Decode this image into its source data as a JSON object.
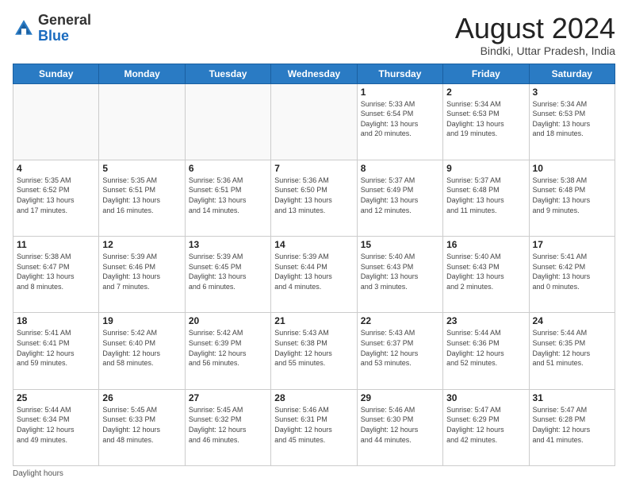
{
  "header": {
    "logo_general": "General",
    "logo_blue": "Blue",
    "month_title": "August 2024",
    "subtitle": "Bindki, Uttar Pradesh, India"
  },
  "days_of_week": [
    "Sunday",
    "Monday",
    "Tuesday",
    "Wednesday",
    "Thursday",
    "Friday",
    "Saturday"
  ],
  "weeks": [
    [
      {
        "day": "",
        "info": ""
      },
      {
        "day": "",
        "info": ""
      },
      {
        "day": "",
        "info": ""
      },
      {
        "day": "",
        "info": ""
      },
      {
        "day": "1",
        "info": "Sunrise: 5:33 AM\nSunset: 6:54 PM\nDaylight: 13 hours\nand 20 minutes."
      },
      {
        "day": "2",
        "info": "Sunrise: 5:34 AM\nSunset: 6:53 PM\nDaylight: 13 hours\nand 19 minutes."
      },
      {
        "day": "3",
        "info": "Sunrise: 5:34 AM\nSunset: 6:53 PM\nDaylight: 13 hours\nand 18 minutes."
      }
    ],
    [
      {
        "day": "4",
        "info": "Sunrise: 5:35 AM\nSunset: 6:52 PM\nDaylight: 13 hours\nand 17 minutes."
      },
      {
        "day": "5",
        "info": "Sunrise: 5:35 AM\nSunset: 6:51 PM\nDaylight: 13 hours\nand 16 minutes."
      },
      {
        "day": "6",
        "info": "Sunrise: 5:36 AM\nSunset: 6:51 PM\nDaylight: 13 hours\nand 14 minutes."
      },
      {
        "day": "7",
        "info": "Sunrise: 5:36 AM\nSunset: 6:50 PM\nDaylight: 13 hours\nand 13 minutes."
      },
      {
        "day": "8",
        "info": "Sunrise: 5:37 AM\nSunset: 6:49 PM\nDaylight: 13 hours\nand 12 minutes."
      },
      {
        "day": "9",
        "info": "Sunrise: 5:37 AM\nSunset: 6:48 PM\nDaylight: 13 hours\nand 11 minutes."
      },
      {
        "day": "10",
        "info": "Sunrise: 5:38 AM\nSunset: 6:48 PM\nDaylight: 13 hours\nand 9 minutes."
      }
    ],
    [
      {
        "day": "11",
        "info": "Sunrise: 5:38 AM\nSunset: 6:47 PM\nDaylight: 13 hours\nand 8 minutes."
      },
      {
        "day": "12",
        "info": "Sunrise: 5:39 AM\nSunset: 6:46 PM\nDaylight: 13 hours\nand 7 minutes."
      },
      {
        "day": "13",
        "info": "Sunrise: 5:39 AM\nSunset: 6:45 PM\nDaylight: 13 hours\nand 6 minutes."
      },
      {
        "day": "14",
        "info": "Sunrise: 5:39 AM\nSunset: 6:44 PM\nDaylight: 13 hours\nand 4 minutes."
      },
      {
        "day": "15",
        "info": "Sunrise: 5:40 AM\nSunset: 6:43 PM\nDaylight: 13 hours\nand 3 minutes."
      },
      {
        "day": "16",
        "info": "Sunrise: 5:40 AM\nSunset: 6:43 PM\nDaylight: 13 hours\nand 2 minutes."
      },
      {
        "day": "17",
        "info": "Sunrise: 5:41 AM\nSunset: 6:42 PM\nDaylight: 13 hours\nand 0 minutes."
      }
    ],
    [
      {
        "day": "18",
        "info": "Sunrise: 5:41 AM\nSunset: 6:41 PM\nDaylight: 12 hours\nand 59 minutes."
      },
      {
        "day": "19",
        "info": "Sunrise: 5:42 AM\nSunset: 6:40 PM\nDaylight: 12 hours\nand 58 minutes."
      },
      {
        "day": "20",
        "info": "Sunrise: 5:42 AM\nSunset: 6:39 PM\nDaylight: 12 hours\nand 56 minutes."
      },
      {
        "day": "21",
        "info": "Sunrise: 5:43 AM\nSunset: 6:38 PM\nDaylight: 12 hours\nand 55 minutes."
      },
      {
        "day": "22",
        "info": "Sunrise: 5:43 AM\nSunset: 6:37 PM\nDaylight: 12 hours\nand 53 minutes."
      },
      {
        "day": "23",
        "info": "Sunrise: 5:44 AM\nSunset: 6:36 PM\nDaylight: 12 hours\nand 52 minutes."
      },
      {
        "day": "24",
        "info": "Sunrise: 5:44 AM\nSunset: 6:35 PM\nDaylight: 12 hours\nand 51 minutes."
      }
    ],
    [
      {
        "day": "25",
        "info": "Sunrise: 5:44 AM\nSunset: 6:34 PM\nDaylight: 12 hours\nand 49 minutes."
      },
      {
        "day": "26",
        "info": "Sunrise: 5:45 AM\nSunset: 6:33 PM\nDaylight: 12 hours\nand 48 minutes."
      },
      {
        "day": "27",
        "info": "Sunrise: 5:45 AM\nSunset: 6:32 PM\nDaylight: 12 hours\nand 46 minutes."
      },
      {
        "day": "28",
        "info": "Sunrise: 5:46 AM\nSunset: 6:31 PM\nDaylight: 12 hours\nand 45 minutes."
      },
      {
        "day": "29",
        "info": "Sunrise: 5:46 AM\nSunset: 6:30 PM\nDaylight: 12 hours\nand 44 minutes."
      },
      {
        "day": "30",
        "info": "Sunrise: 5:47 AM\nSunset: 6:29 PM\nDaylight: 12 hours\nand 42 minutes."
      },
      {
        "day": "31",
        "info": "Sunrise: 5:47 AM\nSunset: 6:28 PM\nDaylight: 12 hours\nand 41 minutes."
      }
    ]
  ],
  "footer": "Daylight hours"
}
